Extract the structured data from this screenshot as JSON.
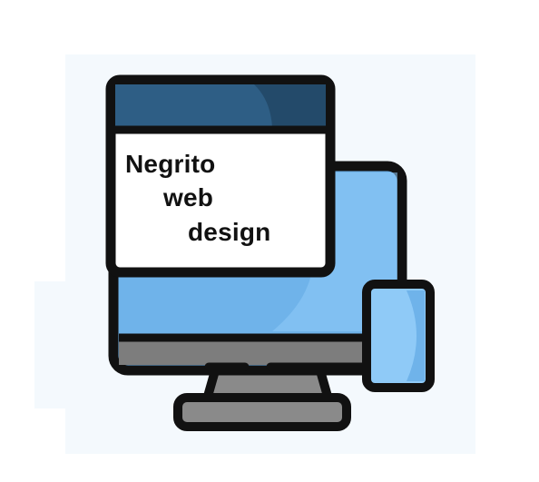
{
  "brand": {
    "line1": "Negrito",
    "line2": "web",
    "line3": "design"
  },
  "colors": {
    "outline": "#111111",
    "title_bar": "#2e5e85",
    "title_bar_shade": "#234a6a",
    "screen": "#6fb3ea",
    "screen_light": "#8fcaf7",
    "window_body": "#ffffff",
    "stand": "#8a8a8a",
    "bezel": "#7d7d7d",
    "background": "#f4f9fd"
  },
  "icons": [
    "desktop-monitor-icon",
    "browser-window-icon",
    "smartphone-icon"
  ]
}
